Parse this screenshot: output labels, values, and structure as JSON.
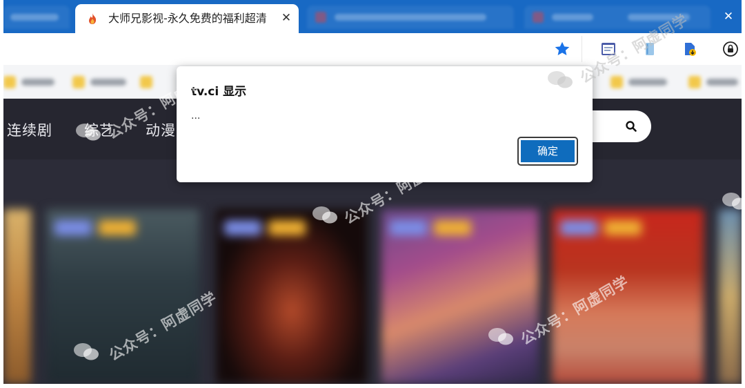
{
  "browser": {
    "active_tab_title": "大师兄影视-永久免费的福利超清",
    "tab_close": "✕",
    "window_close": "✕"
  },
  "site": {
    "nav": [
      "连续剧",
      "综艺",
      "动漫"
    ]
  },
  "dialog": {
    "title": "tv.ci 显示",
    "message": "...",
    "ok_label": "确定"
  },
  "watermark": {
    "text": "公众号：阿虚同学"
  },
  "colors": {
    "tab_strip": "#1869c4",
    "ok_button": "#0f6cbd",
    "star": "#1a73e8",
    "site_bg": "#262630"
  }
}
